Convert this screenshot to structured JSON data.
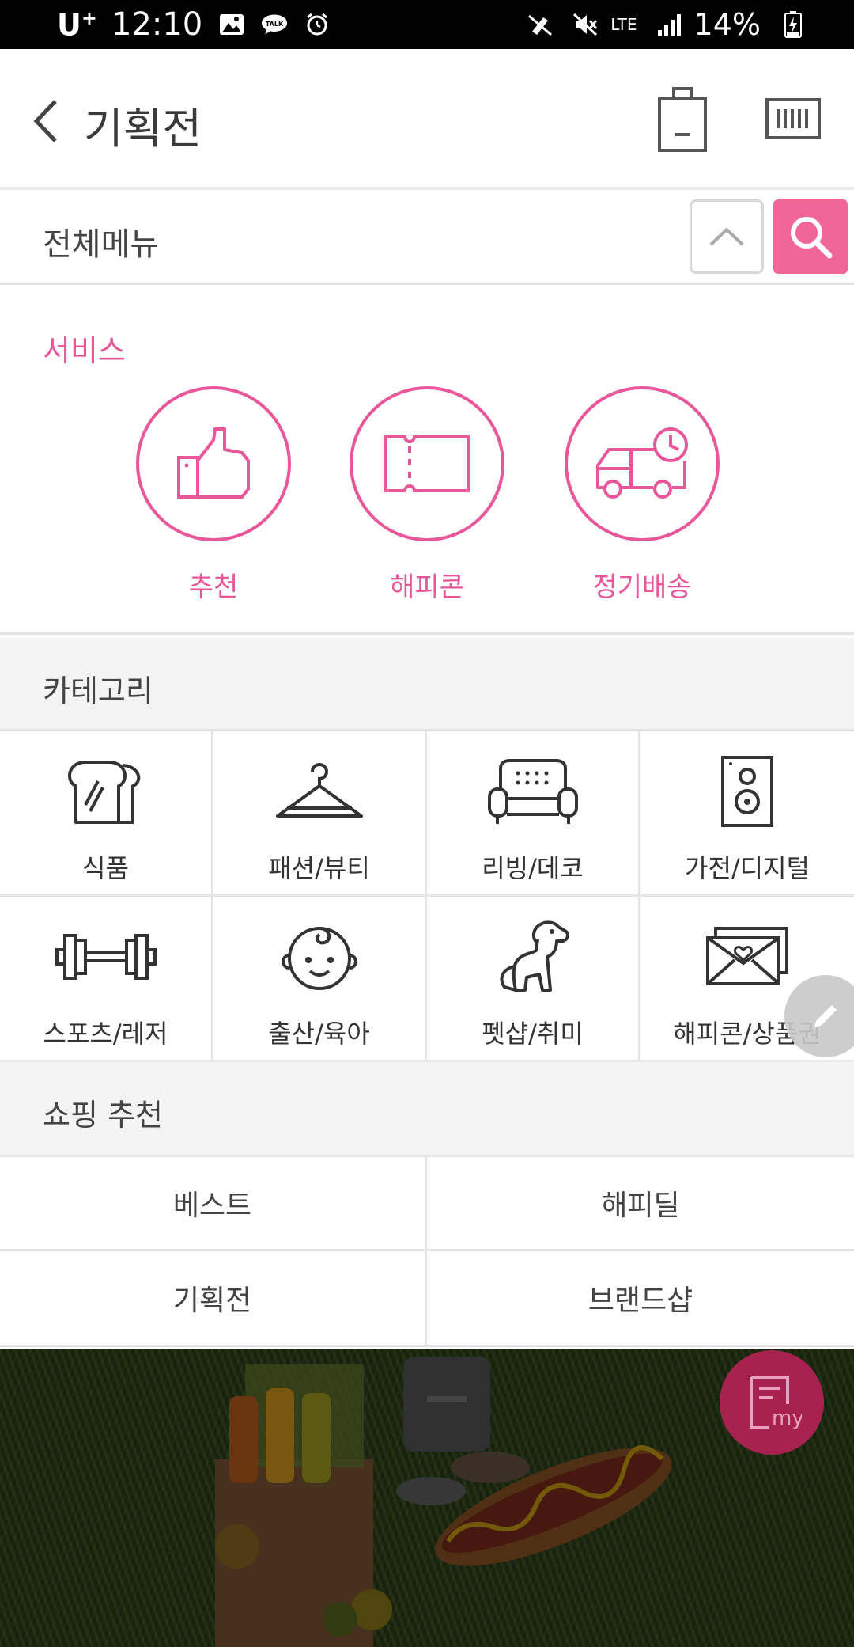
{
  "status_bar": {
    "carrier": "U",
    "carrier_sup": "+",
    "time": "12:10",
    "network": "LTE",
    "battery": "14%"
  },
  "header": {
    "title": "기획전"
  },
  "menu_bar": {
    "title": "전체메뉴"
  },
  "services": {
    "label": "서비스",
    "items": [
      {
        "label": "추천",
        "icon": "thumbs-up-icon"
      },
      {
        "label": "해피콘",
        "icon": "ticket-icon"
      },
      {
        "label": "정기배송",
        "icon": "delivery-truck-clock-icon"
      }
    ]
  },
  "category": {
    "label": "카테고리",
    "items": [
      {
        "label": "식품",
        "icon": "bread-icon"
      },
      {
        "label": "패션/뷰티",
        "icon": "hanger-icon"
      },
      {
        "label": "리빙/데코",
        "icon": "sofa-icon"
      },
      {
        "label": "가전/디지털",
        "icon": "speaker-icon"
      },
      {
        "label": "스포츠/레저",
        "icon": "dumbbell-icon"
      },
      {
        "label": "출산/육아",
        "icon": "baby-face-icon"
      },
      {
        "label": "펫샵/취미",
        "icon": "dog-icon"
      },
      {
        "label": "해피콘/상품권",
        "icon": "envelope-heart-icon"
      }
    ]
  },
  "shopping": {
    "label": "쇼핑 추천",
    "items": [
      "베스트",
      "해피딜",
      "기획전",
      "브랜드샵"
    ]
  },
  "colors": {
    "accent": "#e9579a",
    "search_button": "#f06696",
    "my_fab": "#a8224f"
  },
  "fab": {
    "my_label": "my"
  }
}
